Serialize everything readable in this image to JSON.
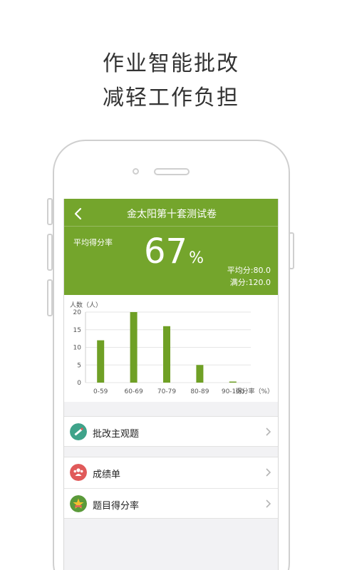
{
  "promo": {
    "line1": "作业智能批改",
    "line2": "减轻工作负担"
  },
  "colors": {
    "accent": "#74a52c",
    "bar": "#6fa025",
    "icon_teal": "#3fa38a",
    "icon_red": "#e05a5a",
    "icon_green": "#5a9a3a"
  },
  "nav": {
    "back_icon": "chevron-left-icon",
    "title": "金太阳第十套测试卷"
  },
  "summary": {
    "avg_rate_label": "平均得分率",
    "avg_rate_value": "67",
    "avg_rate_unit": "%",
    "avg_score": "平均分:80.0",
    "full_score": "满分:120.0"
  },
  "chart_data": {
    "type": "bar",
    "ylabel": "人数（人）",
    "xlabel": "得分率（%）",
    "categories": [
      "0-59",
      "60-69",
      "70-79",
      "80-89",
      "90-100"
    ],
    "values": [
      12,
      20,
      16,
      5,
      0.3
    ],
    "yticks": [
      0,
      5,
      10,
      15,
      20
    ],
    "ylim": [
      0,
      20
    ],
    "grid": true
  },
  "menu": {
    "group1": [
      {
        "label": "批改主观题",
        "icon": "pencil-icon"
      }
    ],
    "group2": [
      {
        "label": "成绩单",
        "icon": "people-icon"
      },
      {
        "label": "题目得分率",
        "icon": "star-icon"
      }
    ]
  }
}
